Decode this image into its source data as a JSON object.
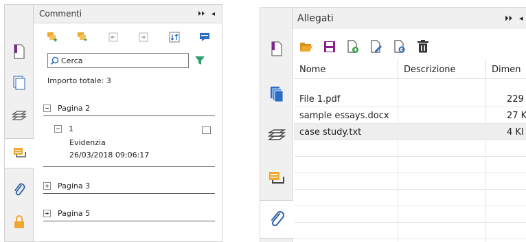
{
  "comments_panel": {
    "title": "Commenti",
    "header_controls": {
      "expand": "⏵⏵",
      "collapse": "◂"
    },
    "search": {
      "value": "Cerca"
    },
    "total_label": "Importo totale: 3",
    "groups": [
      {
        "label": "Pagina 2",
        "expanded": true
      },
      {
        "label": "Pagina 3",
        "expanded": false
      },
      {
        "label": "Pagina 5",
        "expanded": false
      }
    ],
    "comment": {
      "number": "1",
      "type": "Evidenzia",
      "date": "26/03/2018 09:06:17"
    },
    "colors": {
      "accent_orange": "#f0a830",
      "accent_blue": "#2b6cc4",
      "filter_green": "#2e9e6a"
    }
  },
  "attachments_panel": {
    "title": "Allegati",
    "header_controls": {
      "expand": "⏵⏵",
      "collapse": "◂"
    },
    "columns": [
      "Nome",
      "Descrizione",
      "Dimen"
    ],
    "rows": [
      {
        "name": "File 1.pdf",
        "description": "",
        "size": "229"
      },
      {
        "name": "sample essays.docx",
        "description": "",
        "size": "27 K"
      },
      {
        "name": "case study.txt",
        "description": "",
        "size": "4 KI"
      }
    ],
    "colors": {
      "folder": "#f0a830",
      "save": "#8a1e8a",
      "selected_row": "#eeeeee"
    }
  }
}
